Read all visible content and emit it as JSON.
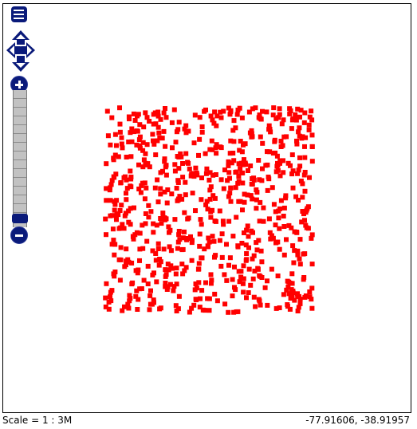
{
  "map": {
    "scale_text": "Scale = 1 : 3M",
    "mouse_position": "-77.91606, -38.91957",
    "feature_color": "#ff0000",
    "control_color": "#0a1a7a"
  },
  "controls": {
    "layer_switcher_icon": "layer-list-icon",
    "pan_icons": [
      "pan-up-icon",
      "pan-left-icon",
      "pan-right-icon",
      "pan-down-icon"
    ],
    "zoom_in_icon": "plus-icon",
    "zoom_out_icon": "minus-icon"
  }
}
